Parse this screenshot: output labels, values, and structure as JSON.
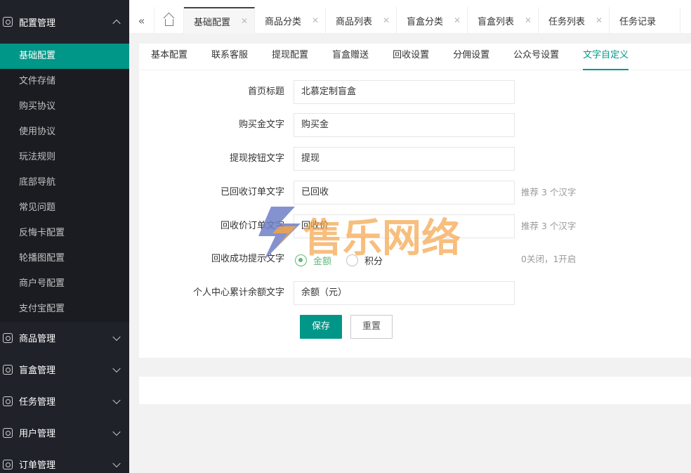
{
  "sidebar": {
    "groups": [
      {
        "label": "配置管理",
        "icon": "settings-icon",
        "open": true,
        "items": [
          "基础配置",
          "文件存储",
          "购买协议",
          "使用协议",
          "玩法规则",
          "底部导航",
          "常见问题",
          "反悔卡配置",
          "轮播图配置",
          "商户号配置",
          "支付宝配置"
        ]
      },
      {
        "label": "商品管理",
        "icon": "goods-icon"
      },
      {
        "label": "盲盒管理",
        "icon": "gift-icon"
      },
      {
        "label": "任务管理",
        "icon": "task-icon"
      },
      {
        "label": "用户管理",
        "icon": "user-icon"
      },
      {
        "label": "订单管理",
        "icon": "order-icon"
      }
    ]
  },
  "topbar": {
    "tabs": [
      {
        "label": "基础配置",
        "active": true
      },
      {
        "label": "商品分类"
      },
      {
        "label": "商品列表"
      },
      {
        "label": "盲盒分类"
      },
      {
        "label": "盲盒列表"
      },
      {
        "label": "任务列表"
      },
      {
        "label": "任务记录"
      }
    ]
  },
  "subtabs": [
    "基本配置",
    "联系客服",
    "提现配置",
    "盲盒赠送",
    "回收设置",
    "分佣设置",
    "公众号设置",
    "文字自定义"
  ],
  "form": {
    "fields": [
      {
        "label": "首页标题",
        "value": "北慕定制盲盒",
        "hint": ""
      },
      {
        "label": "购买金文字",
        "value": "购买金",
        "hint": ""
      },
      {
        "label": "提现按钮文字",
        "value": "提现",
        "hint": ""
      },
      {
        "label": "已回收订单文字",
        "value": "已回收",
        "hint": "推荐 3 个汉字"
      },
      {
        "label": "回收价订单文字",
        "value": "回收价",
        "hint": "推荐 3 个汉字"
      }
    ],
    "radio_row": {
      "label": "回收成功提示文字",
      "options": [
        "金额",
        "积分"
      ],
      "selected": "金额",
      "hint": "0关闭，1开启"
    },
    "last_field": {
      "label": "个人中心累计余额文字",
      "value": "余额（元）"
    },
    "save": "保存",
    "reset": "重置"
  },
  "watermark": {
    "text": "售乐网络"
  },
  "colors": {
    "accent": "#009688",
    "sidebar_bg": "#20222a",
    "radio_on": "#5fb878",
    "watermark_orange": "#f5a347"
  }
}
